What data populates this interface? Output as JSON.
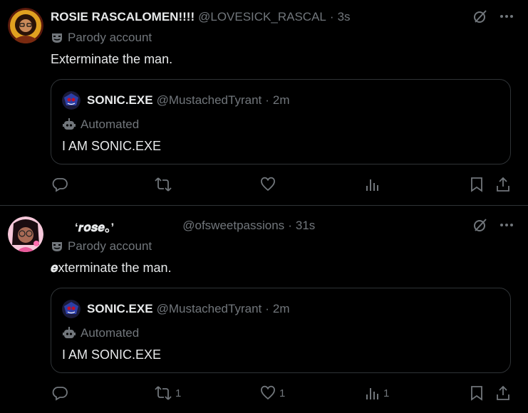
{
  "tweets": [
    {
      "name": "ROSIE RASCALOMEN!!!!",
      "handle": "@LOVESICK_RASCAL",
      "separator": "·",
      "time": "3s",
      "label": "Parody account",
      "label_icon": "parody-mask-icon",
      "text": "Exterminate the man.",
      "quote": {
        "name": "SONIC.EXE",
        "handle": "@MustachedTyrant",
        "separator": "·",
        "time": "2m",
        "label": "Automated",
        "label_icon": "robot-icon",
        "text": "I AM SONIC.EXE"
      },
      "actions": {
        "replies": "",
        "retweets": "",
        "likes": "",
        "views": ""
      }
    },
    {
      "name": "‘𝒓𝒐𝒔𝒆。’",
      "handle": "@ofsweetpassions",
      "separator": "·",
      "time": "31s",
      "label": "Parody account",
      "label_icon": "parody-mask-icon",
      "text_first_letter": "𝒆",
      "text": "xterminate the man.",
      "quote": {
        "name": "SONIC.EXE",
        "handle": "@MustachedTyrant",
        "separator": "·",
        "time": "2m",
        "label": "Automated",
        "label_icon": "robot-icon",
        "text": "I AM SONIC.EXE"
      },
      "actions": {
        "replies": "",
        "retweets": "1",
        "likes": "1",
        "views": "1"
      }
    }
  ],
  "colors": {
    "background": "#000000",
    "text": "#e7e9ea",
    "muted": "#71767b",
    "border": "#2f3336"
  }
}
